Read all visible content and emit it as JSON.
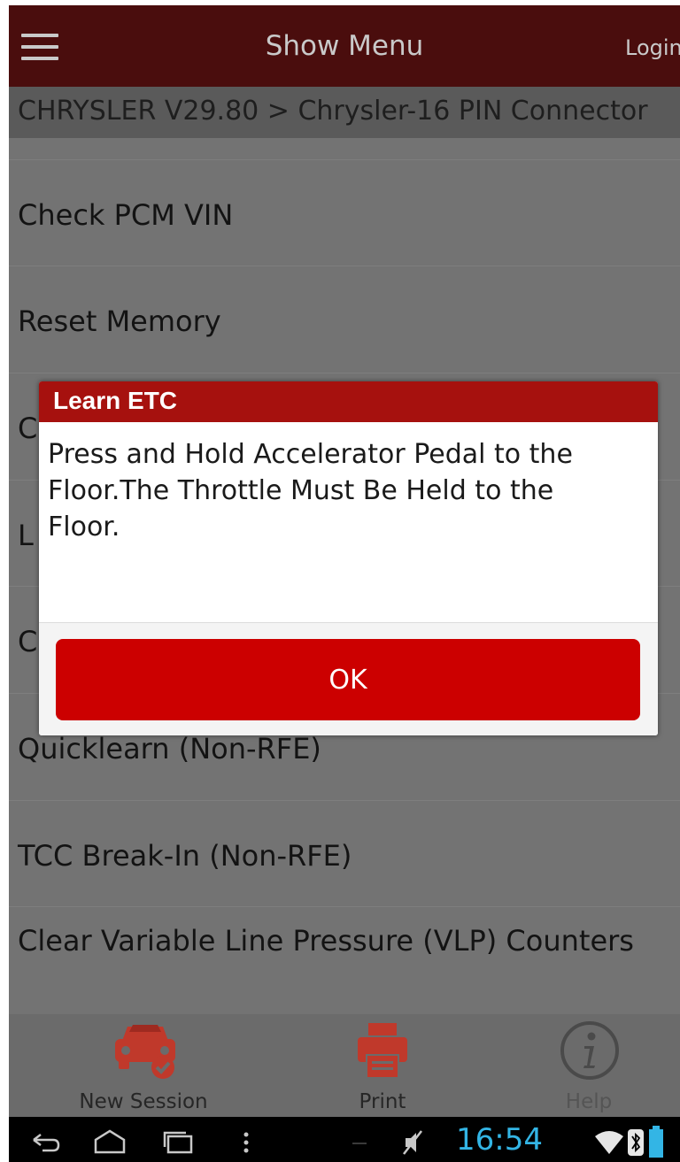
{
  "header": {
    "title": "Show Menu",
    "login_label": "Login"
  },
  "breadcrumb": "CHRYSLER V29.80 > Chrysler-16 PIN Connector",
  "list": {
    "items": [
      {
        "label": "Check PCM VIN"
      },
      {
        "label": "Reset Memory"
      },
      {
        "label": "C"
      },
      {
        "label": "L"
      },
      {
        "label": "C"
      },
      {
        "label": "Quicklearn (Non-RFE)"
      },
      {
        "label": "TCC Break-In (Non-RFE)"
      },
      {
        "label": "Clear Variable Line Pressure (VLP) Counters"
      }
    ]
  },
  "dialog": {
    "title": "Learn ETC",
    "message": "Press and Hold Accelerator Pedal to the Floor.The Throttle Must Be Held to the Floor.",
    "ok_label": "OK"
  },
  "toolbar": {
    "new_session_label": "New Session",
    "print_label": "Print",
    "help_label": "Help"
  },
  "status": {
    "time": "16:54"
  },
  "colors": {
    "header_bg": "#4a0d0d",
    "dialog_title_bg": "#a6110e",
    "ok_button": "#cc0000",
    "icon_red": "#c0392b",
    "clock": "#33b5e5"
  },
  "icons": {
    "menu": "hamburger-icon",
    "new_session": "car-check-icon",
    "print": "printer-icon",
    "help": "info-icon"
  }
}
